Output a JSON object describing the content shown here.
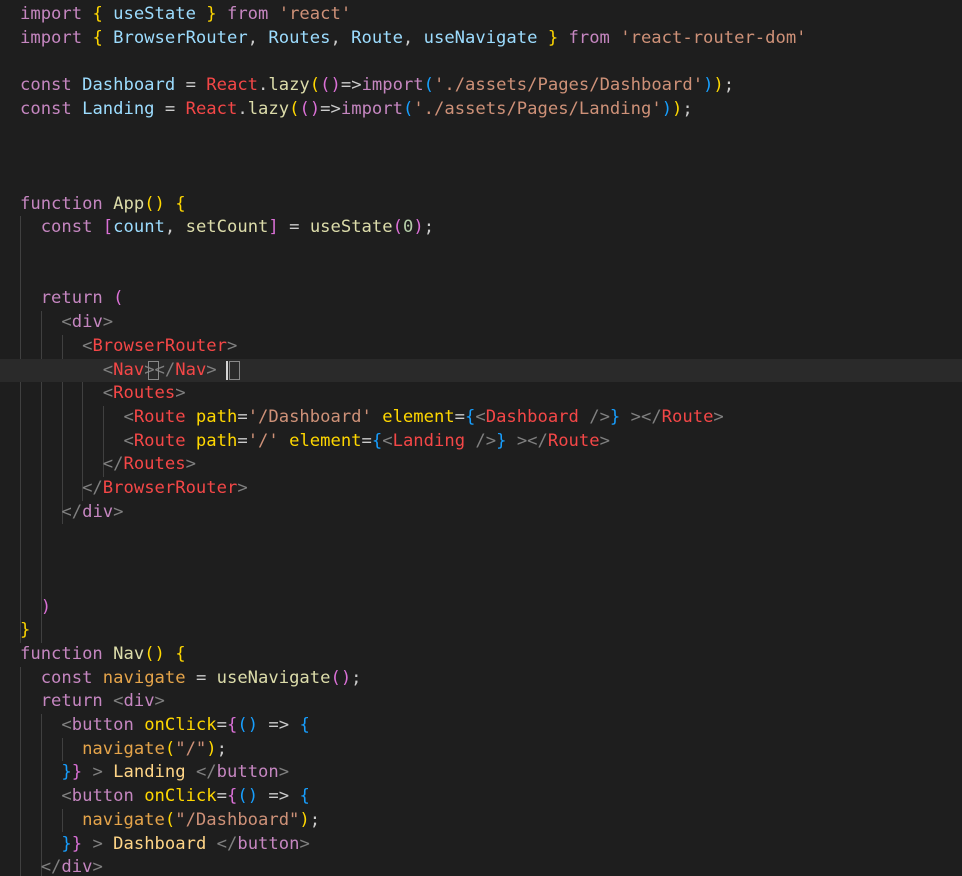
{
  "editor": {
    "colors": {
      "background": "#1e1e1e",
      "keyword": "#c586c0",
      "default": "#cccccc",
      "variable": "#9cdcfe",
      "string": "#ce9178",
      "function": "#dcdcaa",
      "react": "#f44747",
      "jsxTag": "#f44747",
      "jsxBracket": "#808080",
      "attr": "#ffd700",
      "bracket1": "#ffd700",
      "bracket2": "#da70d6",
      "bracket3": "#179fff",
      "number": "#b5cea8",
      "orange": "#e5a44a",
      "text": "#ffd587"
    },
    "lines": [
      [
        [
          "import ",
          "kw"
        ],
        [
          "{ ",
          "b1"
        ],
        [
          "useState ",
          "var"
        ],
        [
          "} ",
          "b1"
        ],
        [
          "from ",
          "kw"
        ],
        [
          "'react'",
          "str"
        ]
      ],
      [
        [
          "import ",
          "kw"
        ],
        [
          "{ ",
          "b1"
        ],
        [
          "BrowserRouter",
          "var"
        ],
        [
          ", ",
          "def"
        ],
        [
          "Routes",
          "var"
        ],
        [
          ", ",
          "def"
        ],
        [
          "Route",
          "var"
        ],
        [
          ", ",
          "def"
        ],
        [
          "useNavigate ",
          "var"
        ],
        [
          "} ",
          "b1"
        ],
        [
          "from ",
          "kw"
        ],
        [
          "'react-router-dom'",
          "str"
        ]
      ],
      [],
      [
        [
          "const ",
          "kw"
        ],
        [
          "Dashboard ",
          "var"
        ],
        [
          "= ",
          "def"
        ],
        [
          "React",
          "react"
        ],
        [
          ".",
          "def"
        ],
        [
          "lazy",
          "fn"
        ],
        [
          "(",
          "b1"
        ],
        [
          "()",
          "b2"
        ],
        [
          "=>",
          "def"
        ],
        [
          "import",
          "kw"
        ],
        [
          "(",
          "b3"
        ],
        [
          "'./assets/Pages/Dashboard'",
          "str"
        ],
        [
          ")",
          "b3"
        ],
        [
          ")",
          "b1"
        ],
        [
          ";",
          "def"
        ]
      ],
      [
        [
          "const ",
          "kw"
        ],
        [
          "Landing ",
          "var"
        ],
        [
          "= ",
          "def"
        ],
        [
          "React",
          "react"
        ],
        [
          ".",
          "def"
        ],
        [
          "lazy",
          "fn"
        ],
        [
          "(",
          "b1"
        ],
        [
          "()",
          "b2"
        ],
        [
          "=>",
          "def"
        ],
        [
          "import",
          "kw"
        ],
        [
          "(",
          "b3"
        ],
        [
          "'./assets/Pages/Landing'",
          "str"
        ],
        [
          ")",
          "b3"
        ],
        [
          ")",
          "b1"
        ],
        [
          ";",
          "def"
        ]
      ],
      [],
      [],
      [],
      [
        [
          "function ",
          "kw"
        ],
        [
          "App",
          "fn"
        ],
        [
          "() ",
          "b1"
        ],
        [
          "{",
          "b1"
        ]
      ],
      [
        [
          "  const ",
          "kw"
        ],
        [
          "[",
          "b2"
        ],
        [
          "count",
          "var"
        ],
        [
          ", ",
          "def"
        ],
        [
          "setCount",
          "fn"
        ],
        [
          "] ",
          "b2"
        ],
        [
          "= ",
          "def"
        ],
        [
          "useState",
          "fn"
        ],
        [
          "(",
          "b2"
        ],
        [
          "0",
          "num"
        ],
        [
          ")",
          "b2"
        ],
        [
          ";",
          "def"
        ]
      ],
      [],
      [],
      [
        [
          "  return ",
          "kw"
        ],
        [
          "(",
          "b2"
        ]
      ],
      [
        [
          "    <",
          "tb"
        ],
        [
          "div",
          "kw"
        ],
        [
          ">",
          "tb"
        ]
      ],
      [
        [
          "      <",
          "tb"
        ],
        [
          "BrowserRouter",
          "tag"
        ],
        [
          ">",
          "tb"
        ]
      ],
      [
        [
          "        <",
          "tb"
        ],
        [
          "Nav",
          "tag"
        ],
        [
          ">",
          "tb"
        ],
        [
          "</",
          "tb"
        ],
        [
          "Nav",
          "tag"
        ],
        [
          ">",
          "tb"
        ]
      ],
      [
        [
          "        <",
          "tb"
        ],
        [
          "Routes",
          "tag"
        ],
        [
          ">",
          "tb"
        ]
      ],
      [
        [
          "          <",
          "tb"
        ],
        [
          "Route ",
          "tag"
        ],
        [
          "path",
          "attr"
        ],
        [
          "=",
          "def"
        ],
        [
          "'/Dashboard' ",
          "str"
        ],
        [
          "element",
          "attr"
        ],
        [
          "=",
          "def"
        ],
        [
          "{",
          "b3"
        ],
        [
          "<",
          "tb"
        ],
        [
          "Dashboard ",
          "tag"
        ],
        [
          "/>",
          "tb"
        ],
        [
          "} ",
          "b3"
        ],
        [
          "></",
          "tb"
        ],
        [
          "Route",
          "tag"
        ],
        [
          ">",
          "tb"
        ]
      ],
      [
        [
          "          <",
          "tb"
        ],
        [
          "Route ",
          "tag"
        ],
        [
          "path",
          "attr"
        ],
        [
          "=",
          "def"
        ],
        [
          "'/' ",
          "str"
        ],
        [
          "element",
          "attr"
        ],
        [
          "=",
          "def"
        ],
        [
          "{",
          "b3"
        ],
        [
          "<",
          "tb"
        ],
        [
          "Landing ",
          "tag"
        ],
        [
          "/>",
          "tb"
        ],
        [
          "} ",
          "b3"
        ],
        [
          "></",
          "tb"
        ],
        [
          "Route",
          "tag"
        ],
        [
          ">",
          "tb"
        ]
      ],
      [
        [
          "        </",
          "tb"
        ],
        [
          "Routes",
          "tag"
        ],
        [
          ">",
          "tb"
        ]
      ],
      [
        [
          "      </",
          "tb"
        ],
        [
          "BrowserRouter",
          "tag"
        ],
        [
          ">",
          "tb"
        ]
      ],
      [
        [
          "    </",
          "tb"
        ],
        [
          "div",
          "kw"
        ],
        [
          ">",
          "tb"
        ]
      ],
      [],
      [],
      [],
      [
        [
          "  )",
          "b2"
        ]
      ],
      [
        [
          "}",
          "b1"
        ]
      ],
      [
        [
          "function ",
          "kw"
        ],
        [
          "Nav",
          "fn"
        ],
        [
          "() ",
          "b1"
        ],
        [
          "{",
          "b1"
        ]
      ],
      [
        [
          "  const ",
          "kw"
        ],
        [
          "navigate ",
          "orange"
        ],
        [
          "= ",
          "def"
        ],
        [
          "useNavigate",
          "fn"
        ],
        [
          "()",
          "b2"
        ],
        [
          ";",
          "def"
        ]
      ],
      [
        [
          "  return ",
          "kw"
        ],
        [
          "<",
          "tb"
        ],
        [
          "div",
          "kw"
        ],
        [
          ">",
          "tb"
        ]
      ],
      [
        [
          "    <",
          "tb"
        ],
        [
          "button ",
          "kw"
        ],
        [
          "onClick",
          "attr"
        ],
        [
          "=",
          "def"
        ],
        [
          "{",
          "b2"
        ],
        [
          "() ",
          "b3"
        ],
        [
          "=> ",
          "def"
        ],
        [
          "{",
          "b3"
        ]
      ],
      [
        [
          "      navigate",
          "orange"
        ],
        [
          "(",
          "b1"
        ],
        [
          "\"/\"",
          "str"
        ],
        [
          ")",
          "b1"
        ],
        [
          ";",
          "def"
        ]
      ],
      [
        [
          "    }",
          "b3"
        ],
        [
          "} ",
          "b2"
        ],
        [
          "> ",
          "tb"
        ],
        [
          "Landing ",
          "text"
        ],
        [
          "</",
          "tb"
        ],
        [
          "button",
          "kw"
        ],
        [
          ">",
          "tb"
        ]
      ],
      [
        [
          "    <",
          "tb"
        ],
        [
          "button ",
          "kw"
        ],
        [
          "onClick",
          "attr"
        ],
        [
          "=",
          "def"
        ],
        [
          "{",
          "b2"
        ],
        [
          "() ",
          "b3"
        ],
        [
          "=> ",
          "def"
        ],
        [
          "{",
          "b3"
        ]
      ],
      [
        [
          "      navigate",
          "orange"
        ],
        [
          "(",
          "b1"
        ],
        [
          "\"/Dashboard\"",
          "str"
        ],
        [
          ")",
          "b1"
        ],
        [
          ";",
          "def"
        ]
      ],
      [
        [
          "    }",
          "b3"
        ],
        [
          "} ",
          "b2"
        ],
        [
          "> ",
          "tb"
        ],
        [
          "Dashboard ",
          "text"
        ],
        [
          "</",
          "tb"
        ],
        [
          "button",
          "kw"
        ],
        [
          ">",
          "tb"
        ]
      ],
      [
        [
          "  </",
          "tb"
        ],
        [
          "div",
          "kw"
        ],
        [
          ">",
          "tb"
        ]
      ]
    ]
  }
}
